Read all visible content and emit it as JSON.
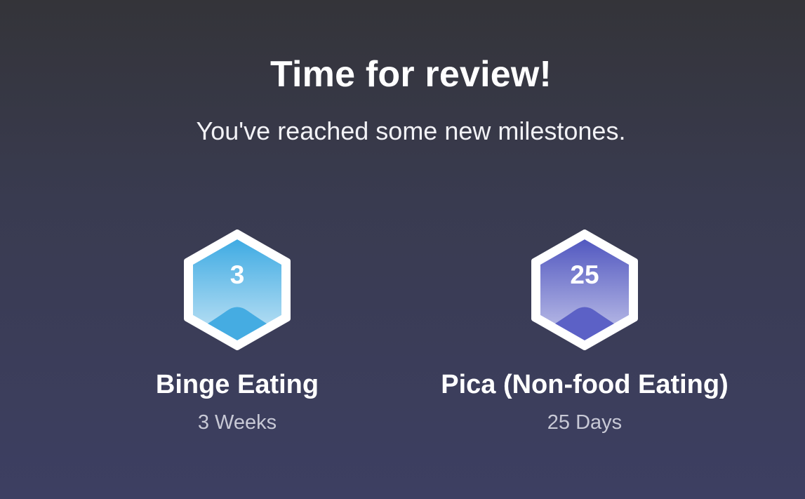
{
  "header": {
    "title": "Time for review!",
    "subtitle": "You've reached some new milestones."
  },
  "milestones": [
    {
      "number": "3",
      "name": "Binge Eating",
      "duration": "3 Weeks",
      "badge_icon": "hexagon-badge-icon",
      "colors": {
        "top": "#3fabe3",
        "bottom": "#c4e4f5",
        "hill": "#45ace2"
      }
    },
    {
      "number": "25",
      "name": "Pica (Non-food Eating)",
      "duration": "25 Days",
      "badge_icon": "hexagon-badge-icon",
      "colors": {
        "top": "#5258c0",
        "bottom": "#c2c4ea",
        "hill": "#5c61c6"
      }
    }
  ]
}
